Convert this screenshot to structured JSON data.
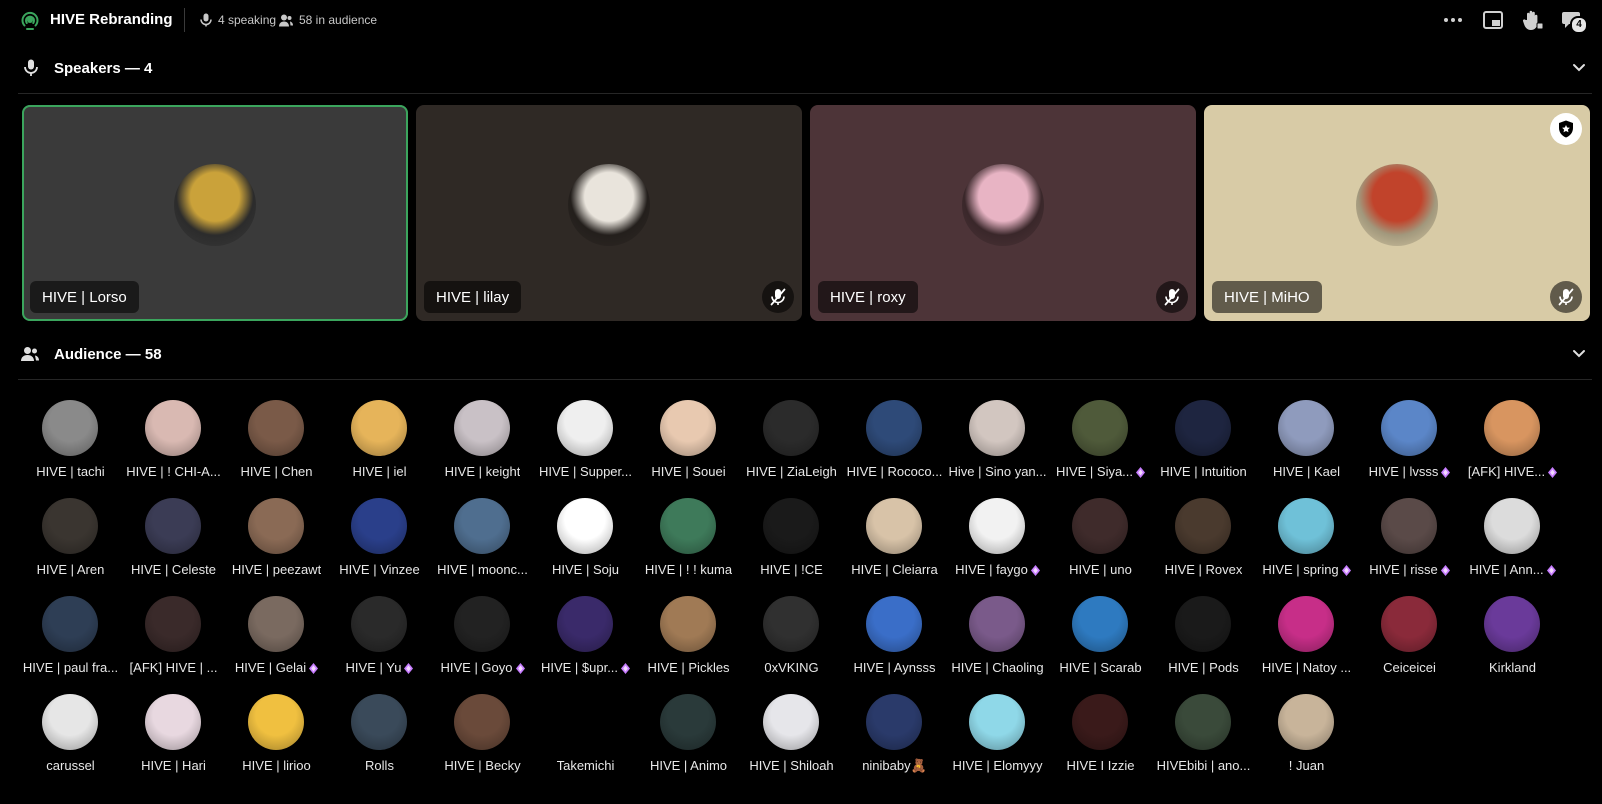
{
  "header": {
    "title": "HIVE Rebranding",
    "speaking": "4 speaking",
    "audience_count": "58 in audience",
    "inbox_badge": "4"
  },
  "speakers_section": {
    "label": "Speakers — 4"
  },
  "audience_section": {
    "label": "Audience — 58"
  },
  "colors": {
    "speaking_ring": "#3ba55d",
    "badge_gem": "#c77dff"
  },
  "speakers": [
    {
      "name": "HIVE | Lorso",
      "bg": "#3a3a3a",
      "speaking": true,
      "muted": false,
      "moderator": false,
      "av": "#caa23a"
    },
    {
      "name": "HIVE | lilay",
      "bg": "#2f2925",
      "speaking": false,
      "muted": true,
      "moderator": false,
      "av": "#e9e4dc"
    },
    {
      "name": "HIVE | roxy",
      "bg": "#4d3438",
      "speaking": false,
      "muted": true,
      "moderator": false,
      "av": "#e8b4c4"
    },
    {
      "name": "HIVE | MiHO",
      "bg": "#d8cba6",
      "speaking": false,
      "muted": true,
      "moderator": true,
      "av": "#c1432b"
    }
  ],
  "audience": [
    {
      "name": "HIVE | tachi",
      "gem": false,
      "av": "#8a8a8a"
    },
    {
      "name": "HIVE | ! CHI-A...",
      "gem": false,
      "av": "#d9b9b2"
    },
    {
      "name": "HIVE | Chen",
      "gem": false,
      "av": "#7a5a48"
    },
    {
      "name": "HIVE | iel",
      "gem": false,
      "av": "#e6b45a"
    },
    {
      "name": "HIVE | keight",
      "gem": false,
      "av": "#c9c1c6"
    },
    {
      "name": "HIVE | Supper...",
      "gem": false,
      "av": "#efefef"
    },
    {
      "name": "HIVE | Souei",
      "gem": false,
      "av": "#e8c9b0"
    },
    {
      "name": "HIVE | ZiaLeigh",
      "gem": false,
      "av": "#2b2b2b"
    },
    {
      "name": "HIVE | Rococo...",
      "gem": false,
      "av": "#2e4a78"
    },
    {
      "name": "Hive | Sino yan...",
      "gem": false,
      "av": "#d2c6c0"
    },
    {
      "name": "HIVE | Siya...",
      "gem": true,
      "av": "#4f5a3a"
    },
    {
      "name": "HIVE | Intuition",
      "gem": false,
      "av": "#1e2540"
    },
    {
      "name": "HIVE | Kael",
      "gem": false,
      "av": "#8f9bbd"
    },
    {
      "name": "HIVE | lvsss",
      "gem": true,
      "av": "#5b86c8"
    },
    {
      "name": "[AFK] HIVE...",
      "gem": true,
      "av": "#d89560"
    },
    {
      "name": "HIVE | Aren",
      "gem": false,
      "av": "#3a3530"
    },
    {
      "name": "HIVE | Celeste",
      "gem": false,
      "av": "#3b3c55"
    },
    {
      "name": "HIVE | peezawt",
      "gem": false,
      "av": "#8a6a55"
    },
    {
      "name": "HIVE | Vinzee",
      "gem": false,
      "av": "#2a3f8a"
    },
    {
      "name": "HIVE | moonc...",
      "gem": false,
      "av": "#4f6e8f"
    },
    {
      "name": "HIVE | Soju",
      "gem": false,
      "av": "#ffffff"
    },
    {
      "name": "HIVE | ! ! kuma",
      "gem": false,
      "av": "#3e7a5a"
    },
    {
      "name": "HIVE | !CE",
      "gem": false,
      "av": "#1a1a1a"
    },
    {
      "name": "HIVE | Cleiarra",
      "gem": false,
      "av": "#d8c3a8"
    },
    {
      "name": "HIVE | faygo",
      "gem": true,
      "av": "#f2f2f2"
    },
    {
      "name": "HIVE | uno",
      "gem": false,
      "av": "#3f2b2b"
    },
    {
      "name": "HIVE | Rovex",
      "gem": false,
      "av": "#4a3a2e"
    },
    {
      "name": "HIVE | spring",
      "gem": true,
      "av": "#6fc1d8"
    },
    {
      "name": "HIVE | risse",
      "gem": true,
      "av": "#5a4a48"
    },
    {
      "name": "HIVE | Ann...",
      "gem": true,
      "av": "#dcdcdc"
    },
    {
      "name": "HIVE | paul fra...",
      "gem": false,
      "av": "#2e3e55"
    },
    {
      "name": "[AFK] HIVE | ...",
      "gem": false,
      "av": "#3a2a2a"
    },
    {
      "name": "HIVE | Gelai",
      "gem": true,
      "av": "#7a6a60"
    },
    {
      "name": "HIVE | Yu",
      "gem": true,
      "av": "#2a2a2a"
    },
    {
      "name": "HIVE | Goyo",
      "gem": true,
      "av": "#222222"
    },
    {
      "name": "HIVE | $upr...",
      "gem": true,
      "av": "#3a2a6a"
    },
    {
      "name": "HIVE | Pickles",
      "gem": false,
      "av": "#a07a55"
    },
    {
      "name": "0xVKING",
      "gem": false,
      "av": "#303030"
    },
    {
      "name": "HIVE | Aynsss",
      "gem": false,
      "av": "#3a6ec8"
    },
    {
      "name": "HIVE | Chaoling",
      "gem": false,
      "av": "#7a5a8a"
    },
    {
      "name": "HIVE | Scarab",
      "gem": false,
      "av": "#2e7ac0"
    },
    {
      "name": "HIVE | Pods",
      "gem": false,
      "av": "#1a1a1a"
    },
    {
      "name": "HIVE | Natoy ...",
      "gem": false,
      "av": "#c72e88"
    },
    {
      "name": "Ceiceicei",
      "gem": false,
      "av": "#8a2a3a"
    },
    {
      "name": "Kirkland",
      "gem": false,
      "av": "#6a3a9a"
    },
    {
      "name": "carussel",
      "gem": false,
      "av": "#e6e6e6"
    },
    {
      "name": "HIVE | Hari",
      "gem": false,
      "av": "#e8d8e0"
    },
    {
      "name": "HIVE | lirioo",
      "gem": false,
      "av": "#f0c040"
    },
    {
      "name": "Rolls",
      "gem": false,
      "av": "#3a4a5a"
    },
    {
      "name": "HIVE | Becky",
      "gem": false,
      "av": "#6a4a3a"
    },
    {
      "name": "Takemichi",
      "gem": false,
      "av": "#000000"
    },
    {
      "name": "HIVE | Animo",
      "gem": false,
      "av": "#2a3a3a"
    },
    {
      "name": "HIVE | Shiloah",
      "gem": false,
      "av": "#e6e6ea"
    },
    {
      "name": "ninibaby🧸",
      "gem": false,
      "av": "#2a3a6a"
    },
    {
      "name": "HIVE | Elomyyy",
      "gem": false,
      "av": "#8fd8e8"
    },
    {
      "name": "HIVE I Izzie",
      "gem": false,
      "av": "#3a1a1a"
    },
    {
      "name": "HIVEbibi | ano...",
      "gem": false,
      "av": "#3a4a3a"
    },
    {
      "name": "! Juan",
      "gem": false,
      "av": "#c8b49a"
    }
  ]
}
